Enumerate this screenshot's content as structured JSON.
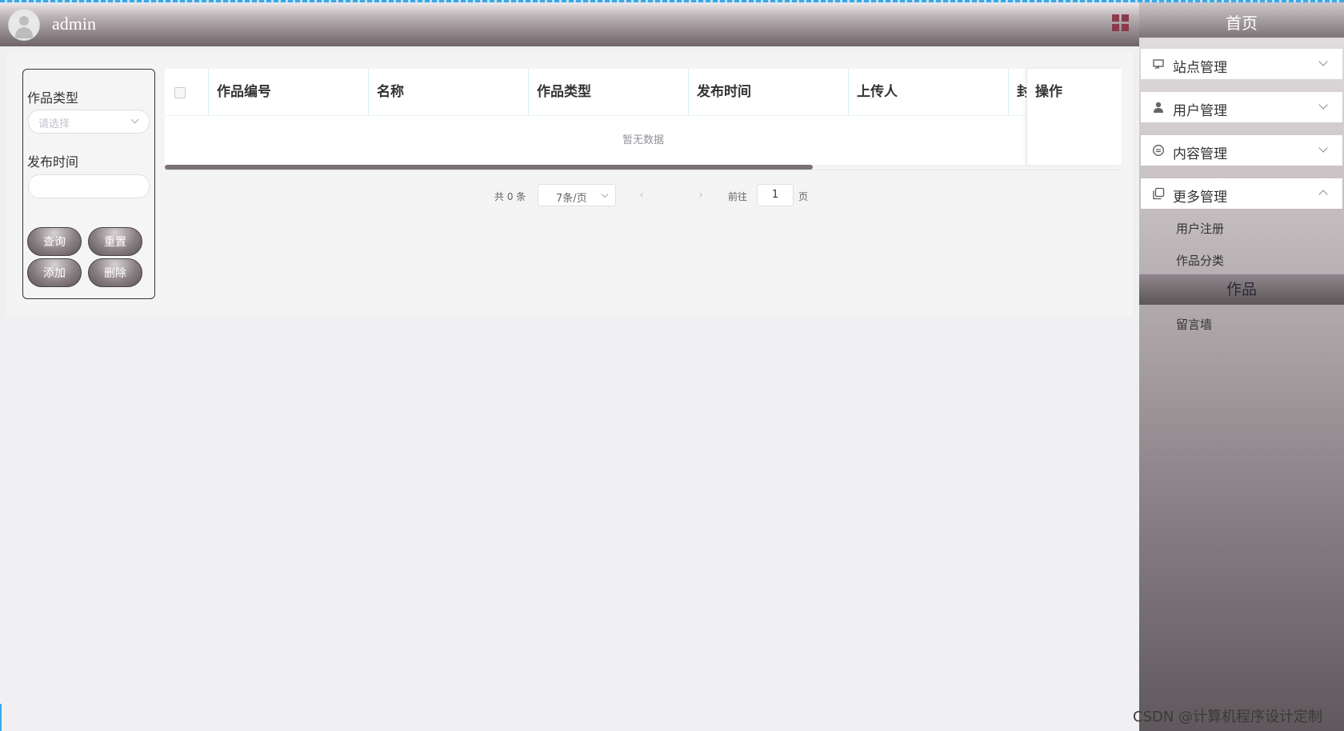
{
  "header": {
    "username": "admin"
  },
  "sidebar": {
    "title": "首页",
    "menus": [
      {
        "label": "站点管理",
        "icon": "monitor-icon"
      },
      {
        "label": "用户管理",
        "icon": "user-icon"
      },
      {
        "label": "内容管理",
        "icon": "comment-icon"
      },
      {
        "label": "更多管理",
        "icon": "copy-icon"
      }
    ],
    "more_sub_items": [
      "用户注册",
      "作品分类"
    ],
    "works_section": "作品",
    "works_sub_items": [
      "留言墙"
    ]
  },
  "search": {
    "type_label": "作品类型",
    "type_placeholder": "请选择",
    "time_label": "发布时间",
    "buttons": {
      "query": "查询",
      "reset": "重置",
      "add": "添加",
      "delete": "删除"
    }
  },
  "table": {
    "columns": [
      "作品编号",
      "名称",
      "作品类型",
      "发布时间",
      "上传人",
      "封"
    ],
    "action_column": "操作",
    "empty_text": "暂无数据"
  },
  "pagination": {
    "total_text": "共 0 条",
    "page_size": "7条/页",
    "goto_label": "前往",
    "goto_value": "1",
    "page_suffix": "页"
  },
  "watermark": "CSDN @计算机程序设计定制",
  "colors": {
    "accent_blue": "#3aa8e6",
    "button_dark": "#6e6468",
    "grid_icon": "#8a3a4a"
  }
}
